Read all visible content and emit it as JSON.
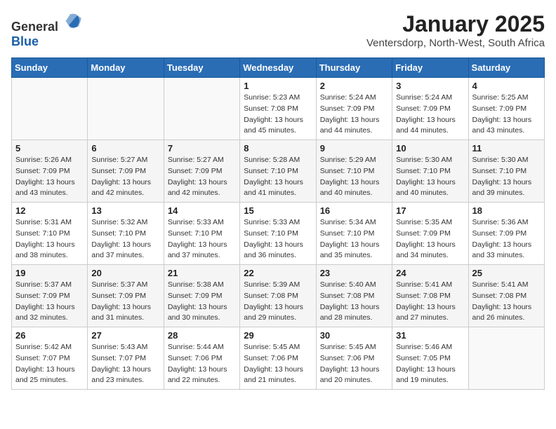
{
  "header": {
    "logo_general": "General",
    "logo_blue": "Blue",
    "month": "January 2025",
    "location": "Ventersdorp, North-West, South Africa"
  },
  "days_of_week": [
    "Sunday",
    "Monday",
    "Tuesday",
    "Wednesday",
    "Thursday",
    "Friday",
    "Saturday"
  ],
  "weeks": [
    [
      {
        "day": "",
        "info": ""
      },
      {
        "day": "",
        "info": ""
      },
      {
        "day": "",
        "info": ""
      },
      {
        "day": "1",
        "info": "Sunrise: 5:23 AM\nSunset: 7:08 PM\nDaylight: 13 hours\nand 45 minutes."
      },
      {
        "day": "2",
        "info": "Sunrise: 5:24 AM\nSunset: 7:09 PM\nDaylight: 13 hours\nand 44 minutes."
      },
      {
        "day": "3",
        "info": "Sunrise: 5:24 AM\nSunset: 7:09 PM\nDaylight: 13 hours\nand 44 minutes."
      },
      {
        "day": "4",
        "info": "Sunrise: 5:25 AM\nSunset: 7:09 PM\nDaylight: 13 hours\nand 43 minutes."
      }
    ],
    [
      {
        "day": "5",
        "info": "Sunrise: 5:26 AM\nSunset: 7:09 PM\nDaylight: 13 hours\nand 43 minutes."
      },
      {
        "day": "6",
        "info": "Sunrise: 5:27 AM\nSunset: 7:09 PM\nDaylight: 13 hours\nand 42 minutes."
      },
      {
        "day": "7",
        "info": "Sunrise: 5:27 AM\nSunset: 7:09 PM\nDaylight: 13 hours\nand 42 minutes."
      },
      {
        "day": "8",
        "info": "Sunrise: 5:28 AM\nSunset: 7:10 PM\nDaylight: 13 hours\nand 41 minutes."
      },
      {
        "day": "9",
        "info": "Sunrise: 5:29 AM\nSunset: 7:10 PM\nDaylight: 13 hours\nand 40 minutes."
      },
      {
        "day": "10",
        "info": "Sunrise: 5:30 AM\nSunset: 7:10 PM\nDaylight: 13 hours\nand 40 minutes."
      },
      {
        "day": "11",
        "info": "Sunrise: 5:30 AM\nSunset: 7:10 PM\nDaylight: 13 hours\nand 39 minutes."
      }
    ],
    [
      {
        "day": "12",
        "info": "Sunrise: 5:31 AM\nSunset: 7:10 PM\nDaylight: 13 hours\nand 38 minutes."
      },
      {
        "day": "13",
        "info": "Sunrise: 5:32 AM\nSunset: 7:10 PM\nDaylight: 13 hours\nand 37 minutes."
      },
      {
        "day": "14",
        "info": "Sunrise: 5:33 AM\nSunset: 7:10 PM\nDaylight: 13 hours\nand 37 minutes."
      },
      {
        "day": "15",
        "info": "Sunrise: 5:33 AM\nSunset: 7:10 PM\nDaylight: 13 hours\nand 36 minutes."
      },
      {
        "day": "16",
        "info": "Sunrise: 5:34 AM\nSunset: 7:10 PM\nDaylight: 13 hours\nand 35 minutes."
      },
      {
        "day": "17",
        "info": "Sunrise: 5:35 AM\nSunset: 7:09 PM\nDaylight: 13 hours\nand 34 minutes."
      },
      {
        "day": "18",
        "info": "Sunrise: 5:36 AM\nSunset: 7:09 PM\nDaylight: 13 hours\nand 33 minutes."
      }
    ],
    [
      {
        "day": "19",
        "info": "Sunrise: 5:37 AM\nSunset: 7:09 PM\nDaylight: 13 hours\nand 32 minutes."
      },
      {
        "day": "20",
        "info": "Sunrise: 5:37 AM\nSunset: 7:09 PM\nDaylight: 13 hours\nand 31 minutes."
      },
      {
        "day": "21",
        "info": "Sunrise: 5:38 AM\nSunset: 7:09 PM\nDaylight: 13 hours\nand 30 minutes."
      },
      {
        "day": "22",
        "info": "Sunrise: 5:39 AM\nSunset: 7:08 PM\nDaylight: 13 hours\nand 29 minutes."
      },
      {
        "day": "23",
        "info": "Sunrise: 5:40 AM\nSunset: 7:08 PM\nDaylight: 13 hours\nand 28 minutes."
      },
      {
        "day": "24",
        "info": "Sunrise: 5:41 AM\nSunset: 7:08 PM\nDaylight: 13 hours\nand 27 minutes."
      },
      {
        "day": "25",
        "info": "Sunrise: 5:41 AM\nSunset: 7:08 PM\nDaylight: 13 hours\nand 26 minutes."
      }
    ],
    [
      {
        "day": "26",
        "info": "Sunrise: 5:42 AM\nSunset: 7:07 PM\nDaylight: 13 hours\nand 25 minutes."
      },
      {
        "day": "27",
        "info": "Sunrise: 5:43 AM\nSunset: 7:07 PM\nDaylight: 13 hours\nand 23 minutes."
      },
      {
        "day": "28",
        "info": "Sunrise: 5:44 AM\nSunset: 7:06 PM\nDaylight: 13 hours\nand 22 minutes."
      },
      {
        "day": "29",
        "info": "Sunrise: 5:45 AM\nSunset: 7:06 PM\nDaylight: 13 hours\nand 21 minutes."
      },
      {
        "day": "30",
        "info": "Sunrise: 5:45 AM\nSunset: 7:06 PM\nDaylight: 13 hours\nand 20 minutes."
      },
      {
        "day": "31",
        "info": "Sunrise: 5:46 AM\nSunset: 7:05 PM\nDaylight: 13 hours\nand 19 minutes."
      },
      {
        "day": "",
        "info": ""
      }
    ]
  ]
}
